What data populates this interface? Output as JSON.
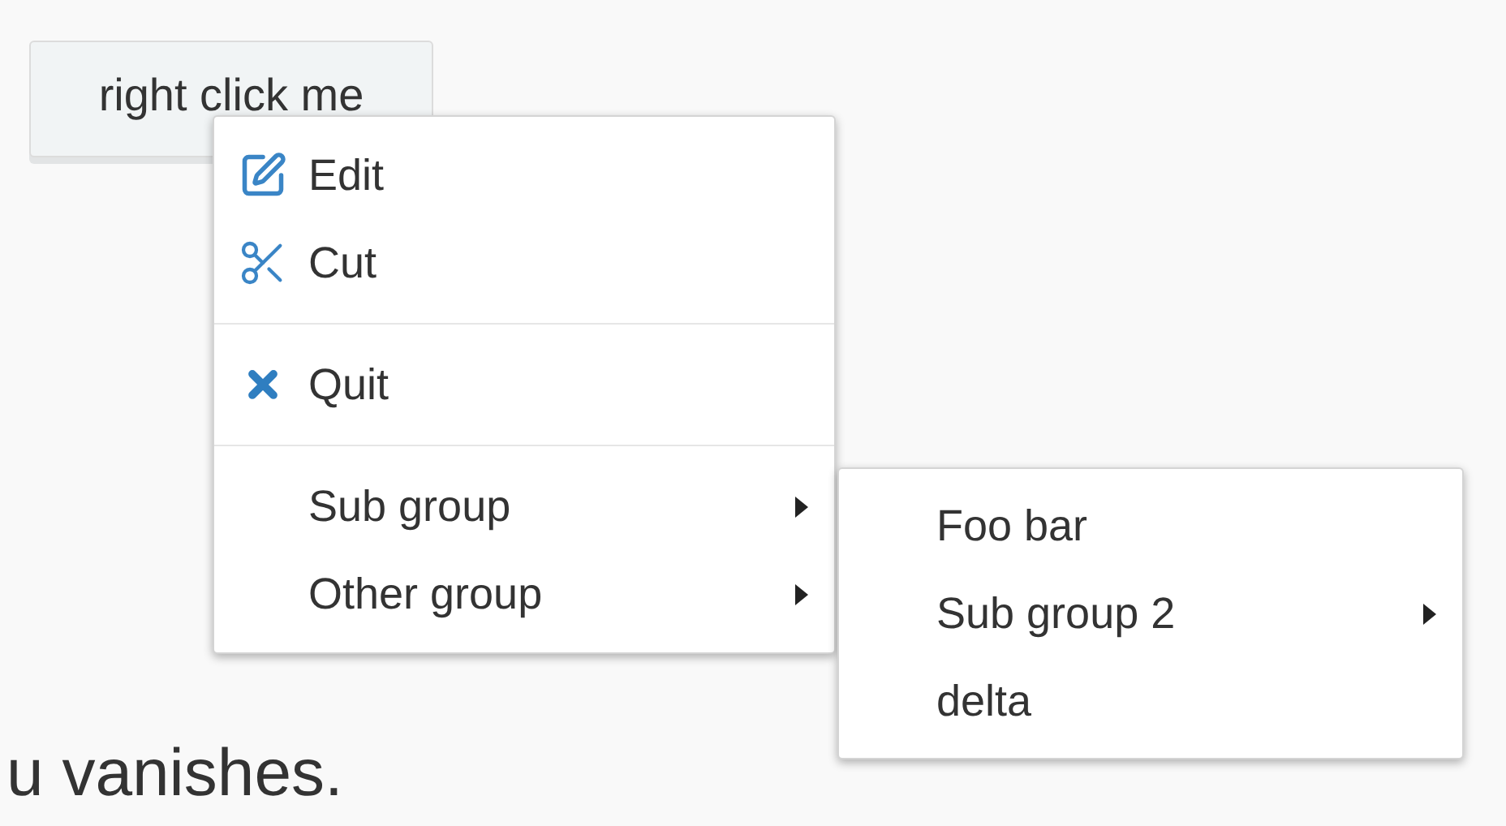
{
  "button": {
    "label": "right click me"
  },
  "context_menu": {
    "items": [
      {
        "kind": "edit",
        "label": "Edit"
      },
      {
        "kind": "cut",
        "label": "Cut"
      },
      {
        "kind": "separator"
      },
      {
        "kind": "quit",
        "label": "Quit"
      },
      {
        "kind": "separator"
      },
      {
        "kind": "submenu",
        "label": "Sub group"
      },
      {
        "kind": "submenu",
        "label": "Other group"
      }
    ]
  },
  "submenu": {
    "items": [
      {
        "kind": "item",
        "label": "Foo bar"
      },
      {
        "kind": "submenu",
        "label": "Sub group 2"
      },
      {
        "kind": "item",
        "label": "delta"
      }
    ]
  },
  "text": "u vanishes."
}
